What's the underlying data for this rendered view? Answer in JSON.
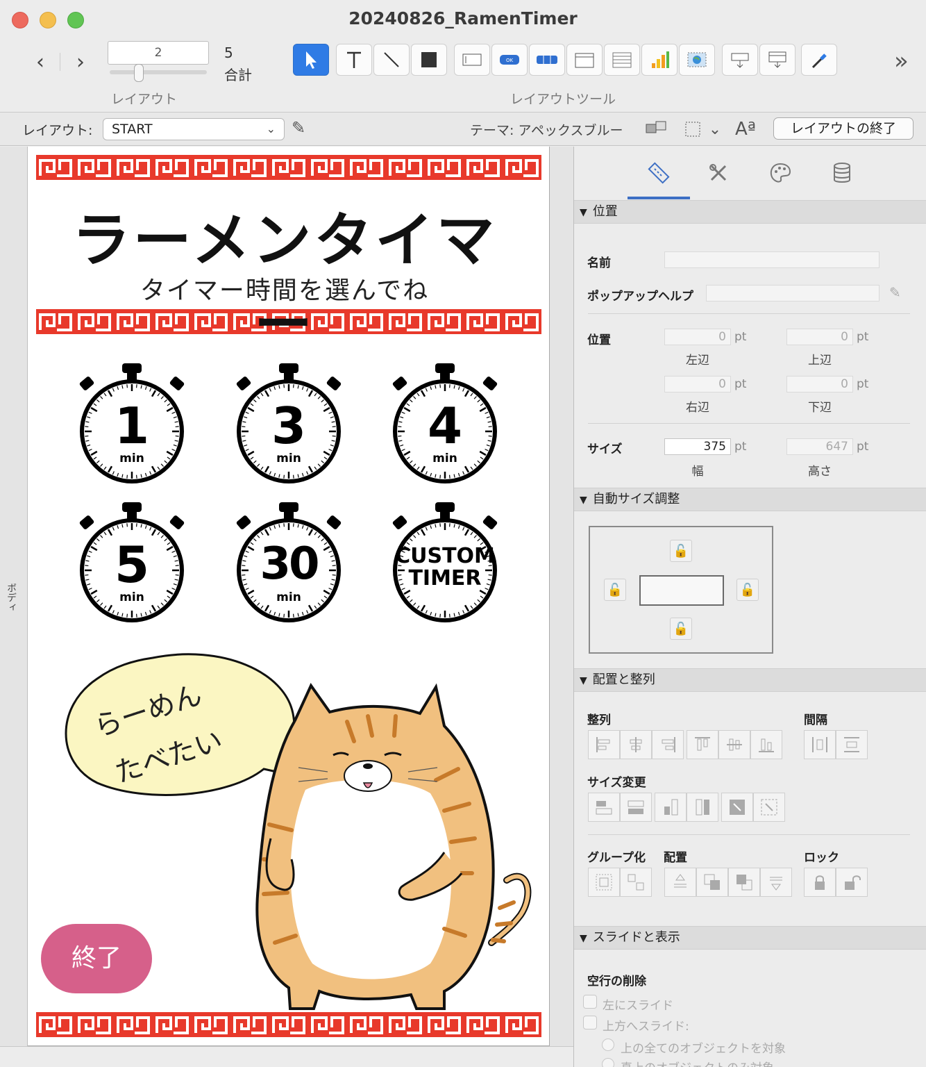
{
  "window": {
    "title": "20240826_RamenTimer"
  },
  "toolbar": {
    "record_value": "2",
    "record_total": "5",
    "record_total_label": "合計",
    "layout_label": "レイアウト",
    "layout_tools_label": "レイアウトツール",
    "back_icon": "chevron-left-icon",
    "forward_icon": "chevron-right-icon"
  },
  "layout_bar": {
    "label": "レイアウト:",
    "selected_layout": "START",
    "theme_label": "テーマ: アペックスブルー",
    "exit_label": "レイアウトの終了"
  },
  "canvas": {
    "side_label": "ボディ",
    "title": "ラーメンタイマー",
    "subtitle": "タイマー時間を選んでね",
    "timers": [
      {
        "value": "1",
        "unit": "min"
      },
      {
        "value": "3",
        "unit": "min"
      },
      {
        "value": "4",
        "unit": "min"
      },
      {
        "value": "5",
        "unit": "min"
      },
      {
        "value": "30",
        "unit": "min"
      }
    ],
    "custom_timer": {
      "line1": "CUSTOM",
      "line2": "TIMER"
    },
    "speech_line1": "らーめん",
    "speech_line2": "たべたい",
    "end_button": "終了",
    "accent_red": "#e8392b",
    "button_pink": "#d6608a"
  },
  "inspector": {
    "section_position": "位置",
    "name_label": "名前",
    "popup_help_label": "ポップアップヘルプ",
    "position_label": "位置",
    "left": {
      "value": "0",
      "unit": "pt",
      "label": "左辺"
    },
    "top": {
      "value": "0",
      "unit": "pt",
      "label": "上辺"
    },
    "right": {
      "value": "0",
      "unit": "pt",
      "label": "右辺"
    },
    "bottom": {
      "value": "0",
      "unit": "pt",
      "label": "下辺"
    },
    "size_label": "サイズ",
    "width": {
      "value": "375",
      "unit": "pt",
      "label": "幅"
    },
    "height": {
      "value": "647",
      "unit": "pt",
      "label": "高さ"
    },
    "section_autosize": "自動サイズ調整",
    "section_arrange": "配置と整列",
    "align_label": "整列",
    "spacing_label": "間隔",
    "resize_label": "サイズ変更",
    "group_label": "グループ化",
    "arrange_label": "配置",
    "lock_label": "ロック",
    "section_slide": "スライドと表示",
    "remove_blank_label": "空行の削除",
    "slide_left": "左にスライド",
    "slide_up": "上方へスライド:",
    "radio_all": "上の全てのオブジェクトを対象",
    "radio_directly": "真上のオブジェクトのみ対象"
  }
}
